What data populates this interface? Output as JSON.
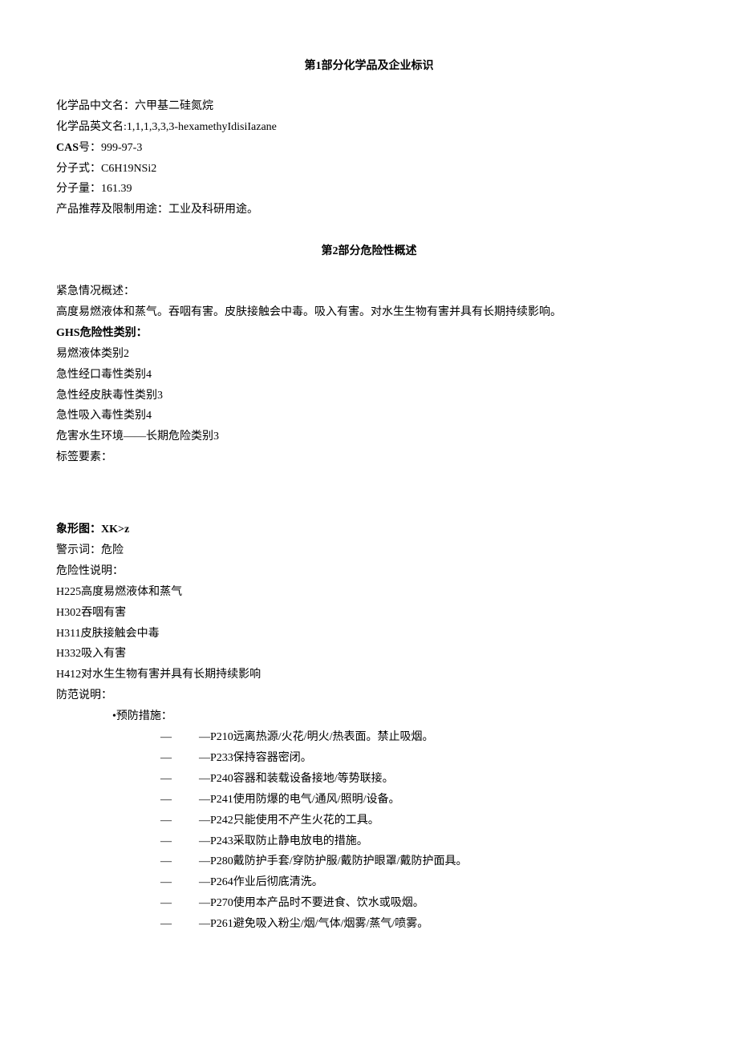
{
  "section1": {
    "title_prefix": "第",
    "title_num": "1",
    "title_suffix": "部分化学品及企业标识",
    "cn_name_label": "化学品中文名：",
    "cn_name_value": "六甲基二硅氮烷",
    "en_name_label": "化学品英文名:",
    "en_name_value": "1,1,1,3,3,3-hexamethyIdisiIazane",
    "cas_label": "CAS",
    "cas_suffix": "号：",
    "cas_value": "999-97-3",
    "formula_label": "分子式：",
    "formula_value": "C6H19NSi2",
    "mw_label": "分子量：",
    "mw_value": "161.39",
    "use_label": "产品推荐及限制用途：",
    "use_value": "工业及科研用途。"
  },
  "section2": {
    "title_prefix": "第",
    "title_num": "2",
    "title_suffix": "部分危险性概述",
    "emergency_label": "紧急情况概述：",
    "emergency_text": "高度易燃液体和蒸气。吞咽有害。皮肤接触会中毒。吸入有害。对水生生物有害并具有长期持续影响。",
    "ghs_label_prefix": "GHS",
    "ghs_label_suffix": "危险性类别：",
    "ghs_categories": [
      "易燃液体类别2",
      "急性经口毒性类别4",
      "急性经皮肤毒性类别3",
      "急性吸入毒性类别4",
      "危害水生环境——长期危险类别3"
    ],
    "label_elements": "标签要素：",
    "pictogram_label": "象形图：",
    "pictogram_value": "XK>z",
    "signal_label": "警示词：",
    "signal_value": "危险",
    "hazard_stmt_label": "危险性说明：",
    "hazard_statements": [
      "H225高度易燃液体和蒸气",
      "H302吞咽有害",
      "H311皮肤接触会中毒",
      "H332吸入有害",
      "H412对水生生物有害并具有长期持续影响"
    ],
    "precaution_label": "防范说明：",
    "prevention_header": "•预防措施：",
    "precautions": [
      "—P210远离热源/火花/明火/热表面。禁止吸烟。",
      "—P233保持容器密闭。",
      "—P240容器和装载设备接地/等势联接。",
      "—P241使用防爆的电气/通风/照明/设备。",
      "—P242只能使用不产生火花的工具。",
      "—P243采取防止静电放电的措施。",
      "—P280戴防护手套/穿防护服/戴防护眼罩/戴防护面具。",
      "—P264作业后彻底清洗。",
      "—P270使用本产品时不要进食、饮水或吸烟。",
      "—P261避免吸入粉尘/烟/气体/烟雾/蒸气/喷雾。"
    ],
    "dash": "—"
  }
}
